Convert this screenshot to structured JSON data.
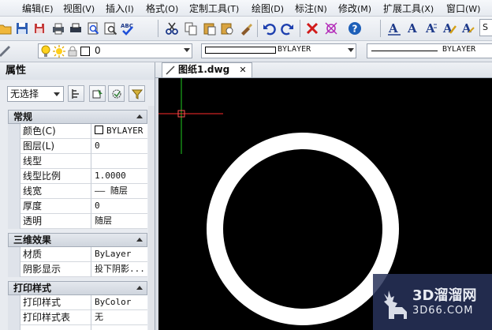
{
  "menu": {
    "items": [
      {
        "label": "编辑",
        "key": "(E)"
      },
      {
        "label": "视图",
        "key": "(V)"
      },
      {
        "label": "插入",
        "key": "(I)"
      },
      {
        "label": "格式",
        "key": "(O)"
      },
      {
        "label": "定制工具",
        "key": "(T)"
      },
      {
        "label": "绘图",
        "key": "(D)"
      },
      {
        "label": "标注",
        "key": "(N)"
      },
      {
        "label": "修改",
        "key": "(M)"
      },
      {
        "label": "扩展工具",
        "key": "(X)"
      },
      {
        "label": "窗口",
        "key": "(W)"
      }
    ]
  },
  "toolbar2": {
    "layer_value": "0",
    "linetype_label": "BYLAYER",
    "lineweight_label": "BYLAYER"
  },
  "properties": {
    "title": "属性",
    "selector_value": "无选择",
    "sections": {
      "general": "常规",
      "three_d": "三维效果",
      "print": "打印样式"
    },
    "general_rows": [
      {
        "label": "颜色(C)",
        "value": "BYLAYER"
      },
      {
        "label": "图层(L)",
        "value": "0"
      },
      {
        "label": "线型",
        "value": ""
      },
      {
        "label": "线型比例",
        "value": "1.0000"
      },
      {
        "label": "线宽",
        "value": "—— 随层"
      },
      {
        "label": "厚度",
        "value": "0"
      },
      {
        "label": "透明",
        "value": "随层"
      }
    ],
    "three_d_rows": [
      {
        "label": "材质",
        "value": "ByLayer"
      },
      {
        "label": "阴影显示",
        "value": "投下阴影..."
      }
    ],
    "print_rows": [
      {
        "label": "打印样式",
        "value": "ByColor"
      },
      {
        "label": "打印样式表",
        "value": "无"
      }
    ]
  },
  "document": {
    "tab_label": "图纸1.dwg",
    "close_glyph": "✕"
  },
  "watermark": {
    "line1": "3D溜溜网",
    "line2": "3D66.COM"
  },
  "colors": {
    "canvas_bg": "#000000",
    "circle": "#ffffff",
    "crosshair_x": "#ff2a2a",
    "crosshair_y": "#22cc22"
  }
}
